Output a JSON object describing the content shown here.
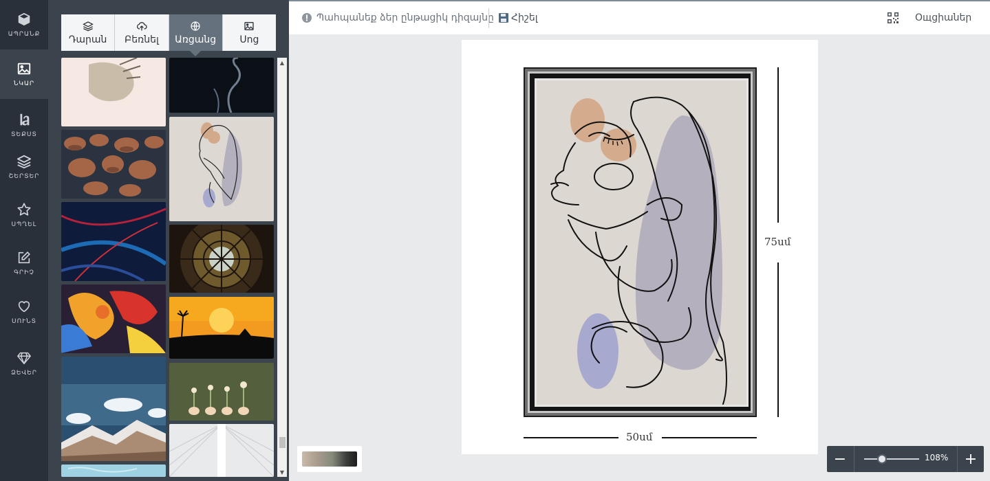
{
  "sidebar": {
    "items": [
      {
        "label": "ԱՊՐԱՆՔ",
        "icon": "cube-icon"
      },
      {
        "label": "ՆԿԱՐ",
        "icon": "image-icon"
      },
      {
        "label": "ՏԵՔՍՏ",
        "icon": "text-icon"
      },
      {
        "label": "ՇԵՐՏԵՐ",
        "icon": "layers-icon"
      },
      {
        "label": "ՍՊՂԵԼ",
        "icon": "star-icon"
      },
      {
        "label": "ԳՐԻՉ",
        "icon": "edit-icon"
      },
      {
        "label": "ՍՈՒՆՏ",
        "icon": "heart-icon"
      },
      {
        "label": "ՁԵՎԵՐ",
        "icon": "diamond-icon"
      }
    ],
    "active_index": 1
  },
  "panel": {
    "tabs": [
      {
        "label": "Դարան",
        "icon": "layers-icon"
      },
      {
        "label": "Բեռնել",
        "icon": "cloud-upload-icon"
      },
      {
        "label": "Առցանց",
        "icon": "globe-icon"
      },
      {
        "label": "Սոց",
        "icon": "image-icon"
      }
    ],
    "active_tab": 2
  },
  "toolbar": {
    "save_design_label": "Պահպանեք ձեր ընթացիկ դիզայնը",
    "remember_label": "Հիշել",
    "options_label": "Ощցիաներ"
  },
  "canvas": {
    "height_label": "75սմ",
    "width_label": "50սմ"
  },
  "zoom": {
    "value": "108%",
    "minus": "−",
    "plus": "+"
  },
  "colors": {
    "rail_bg": "#293039",
    "panel_bg": "#3b434c",
    "active_tab": "#65717d",
    "accent": "#7d8b97"
  }
}
